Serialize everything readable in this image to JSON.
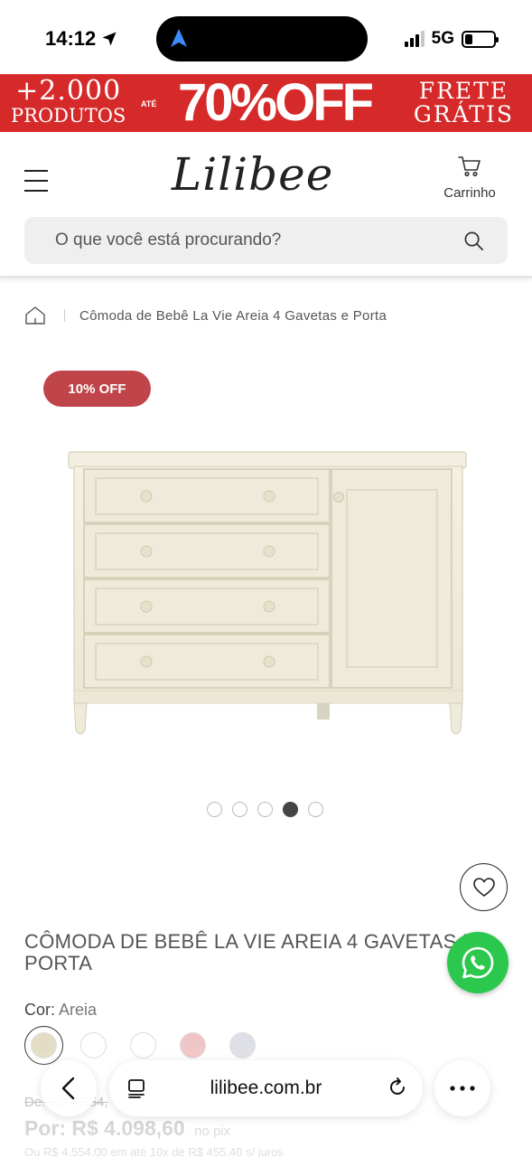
{
  "status_bar": {
    "time": "14:12",
    "network": "5G",
    "icons": [
      "location-arrow-icon",
      "signal-icon",
      "battery-icon"
    ]
  },
  "promo": {
    "line1": "+2.000",
    "line2": "PRODUTOS",
    "ate": "ATÉ",
    "offer": "70%OFF",
    "right1": "FRETE",
    "right2": "GRÁTIS"
  },
  "header": {
    "logo": "Lilibee",
    "cart_label": "Carrinho",
    "search_placeholder": "O que você está procurando?"
  },
  "breadcrumb": {
    "current": "Cômoda de Bebê La Vie Areia 4 Gavetas e Porta"
  },
  "product": {
    "badge": "10% OFF",
    "carousel": {
      "count": 5,
      "active": 4
    },
    "title": "CÔMODA DE BEBÊ LA VIE AREIA 4 GAVETAS E PORTA",
    "color_label": "Cor:",
    "color_value": "Areia",
    "swatches": [
      "#e3dcc4",
      "#ffffff",
      "#ffffff",
      "#f0c4c4",
      "#dedfe6"
    ],
    "price_old_label": "De:",
    "price_old_value": "R$ 4.554,",
    "price_now_label": "Por:",
    "price_now_value": "R$ 4.098,60",
    "price_now_suffix": "no pix",
    "installments": "Ou R$ 4.554,00 em até 10x de R$ 455,40 s/ juros"
  },
  "browser": {
    "url": "lilibee.com.br"
  },
  "colors": {
    "promo_red": "#d62a2a",
    "badge_red": "#c0454a",
    "whatsapp_green": "#2cc84d"
  }
}
